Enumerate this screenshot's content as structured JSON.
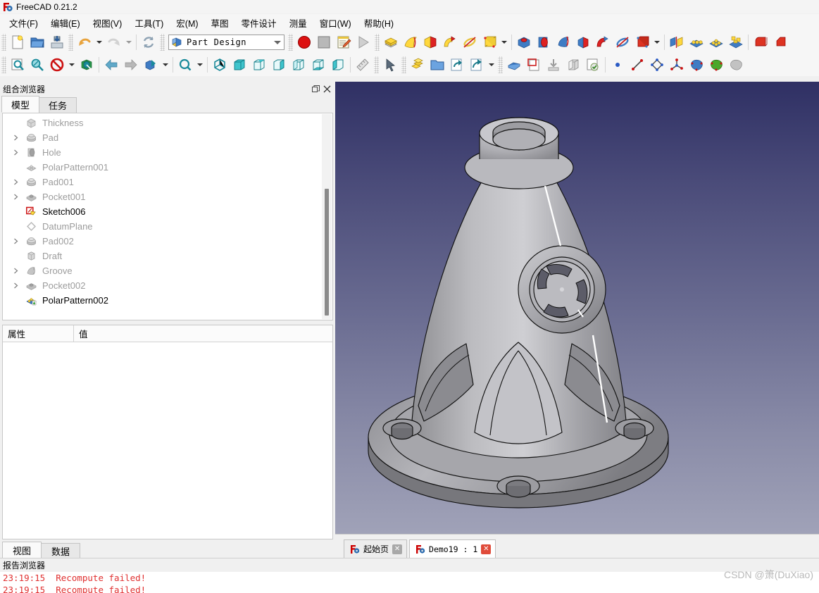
{
  "window": {
    "title": "FreeCAD 0.21.2",
    "app_icon": "freecad-logo-icon"
  },
  "menubar": {
    "items": [
      {
        "label": "文件(F)",
        "name": "menu-file"
      },
      {
        "label": "编辑(E)",
        "name": "menu-edit"
      },
      {
        "label": "视图(V)",
        "name": "menu-view"
      },
      {
        "label": "工具(T)",
        "name": "menu-tools"
      },
      {
        "label": "宏(M)",
        "name": "menu-macro"
      },
      {
        "label": "草图",
        "name": "menu-sketch"
      },
      {
        "label": "零件设计",
        "name": "menu-part-design"
      },
      {
        "label": "测量",
        "name": "menu-measure"
      },
      {
        "label": "窗口(W)",
        "name": "menu-window"
      },
      {
        "label": "帮助(H)",
        "name": "menu-help"
      }
    ]
  },
  "workbench": {
    "selected": "Part Design"
  },
  "combo_view": {
    "title": "组合浏览器",
    "undock_icon": "undock-icon",
    "close_icon": "close-icon",
    "tabs": [
      {
        "label": "模型",
        "name": "tab-model",
        "active": true
      },
      {
        "label": "任务",
        "name": "tab-tasks",
        "active": false
      }
    ],
    "tree": [
      {
        "label": "Thickness",
        "icon": "thickness-icon",
        "expandable": false,
        "active": false
      },
      {
        "label": "Pad",
        "icon": "pad-icon",
        "expandable": true,
        "active": false
      },
      {
        "label": "Hole",
        "icon": "hole-icon",
        "expandable": true,
        "active": false
      },
      {
        "label": "PolarPattern001",
        "icon": "polar-pattern-icon",
        "expandable": false,
        "active": false
      },
      {
        "label": "Pad001",
        "icon": "pad-icon",
        "expandable": true,
        "active": false
      },
      {
        "label": "Pocket001",
        "icon": "pocket-icon",
        "expandable": true,
        "active": false
      },
      {
        "label": "Sketch006",
        "icon": "sketch-icon",
        "expandable": false,
        "active": true
      },
      {
        "label": "DatumPlane",
        "icon": "datum-plane-icon",
        "expandable": false,
        "active": false
      },
      {
        "label": "Pad002",
        "icon": "pad-icon",
        "expandable": true,
        "active": false
      },
      {
        "label": "Draft",
        "icon": "draft-icon",
        "expandable": false,
        "active": false
      },
      {
        "label": "Groove",
        "icon": "groove-icon",
        "expandable": true,
        "active": false
      },
      {
        "label": "Pocket002",
        "icon": "pocket-icon",
        "expandable": true,
        "active": false
      },
      {
        "label": "PolarPattern002",
        "icon": "polar-pattern-icon",
        "expandable": false,
        "active": true
      }
    ],
    "property_columns": [
      {
        "label": "属性",
        "name": "property-name-column"
      },
      {
        "label": "值",
        "name": "property-value-column"
      }
    ],
    "bottom_tabs": [
      {
        "label": "视图",
        "name": "tab-view",
        "active": true
      },
      {
        "label": "数据",
        "name": "tab-data",
        "active": false
      }
    ]
  },
  "viewport": {
    "background_top": "#2f3064",
    "background_bottom": "#a0a2b8",
    "model_color": "#a9a9ac",
    "document_tabs": [
      {
        "label": "起始页",
        "name": "doc-tab-start-page",
        "active": false,
        "close_state": "grey",
        "close_glyph": "✕"
      },
      {
        "label": "Demo19 : 1",
        "name": "doc-tab-demo19",
        "active": true,
        "close_state": "red",
        "close_glyph": "✕"
      }
    ]
  },
  "report_view": {
    "title": "报告浏览器",
    "lines": [
      {
        "time": "23:19:15",
        "message": "Recompute failed!"
      },
      {
        "time": "23:19:15",
        "message": "Recompute failed!"
      }
    ],
    "text_color": "#e03030"
  },
  "watermark": {
    "text": "CSDN @箫(DuXiao)"
  },
  "toolbars": {
    "row1": {
      "file_group": [
        "new-document-icon",
        "open-document-icon",
        "save-document-icon"
      ],
      "edit_group": [
        "undo-icon",
        "undo-dropdown-icon",
        "redo-icon",
        "redo-dropdown-icon",
        "refresh-icon"
      ],
      "macro_group": [
        "macro-record-icon",
        "macro-stop-icon",
        "macro-edit-icon",
        "macro-execute-icon"
      ],
      "additive_group": [
        "pad-icon",
        "revolution-icon",
        "additive-loft-icon",
        "additive-pipe-icon",
        "additive-helix-icon",
        "additive-primitive-icon",
        "additive-primitive-dropdown-icon"
      ],
      "subtractive_group": [
        "pocket-icon",
        "hole-icon",
        "groove-icon",
        "subtractive-loft-icon",
        "subtractive-pipe-icon",
        "subtractive-helix-icon",
        "subtractive-primitive-icon",
        "subtractive-primitive-dropdown-icon"
      ],
      "transform_group": [
        "mirrored-icon",
        "linear-pattern-icon",
        "polar-pattern-icon",
        "multi-transform-icon"
      ],
      "dressup_group": [
        "fillet-icon",
        "chamfer-icon"
      ]
    },
    "row2": {
      "view_group": [
        "fit-all-icon",
        "fit-selection-icon",
        "draw-style-icon",
        "draw-style-dropdown-icon",
        "selection-view-icon"
      ],
      "nav_group": [
        "nav-back-icon",
        "nav-forward-icon",
        "std-view-icon",
        "std-view-dropdown-icon"
      ],
      "zoom_group": [
        "zoom-icon",
        "zoom-dropdown-icon",
        "axonometric-icon",
        "front-view-icon",
        "top-view-icon",
        "right-view-icon",
        "rear-view-icon",
        "bottom-view-icon",
        "left-view-icon",
        "measure-icon"
      ],
      "select_group": [
        "pointer-select-icon"
      ],
      "structure_group": [
        "create-part-icon",
        "create-group-icon",
        "link-make-icon",
        "link-actions-icon",
        "link-actions-dropdown-icon"
      ],
      "sketch_group": [
        "create-sketch-icon",
        "edit-sketch-icon",
        "attach-sketch-icon",
        "view-section-icon",
        "validate-sketch-icon"
      ],
      "geometry_group": [
        "point-icon",
        "line-icon",
        "polyline-icon",
        "datum-line-icon",
        "shape-blue-icon",
        "shape-green-icon",
        "shape-grey-icon"
      ]
    }
  }
}
